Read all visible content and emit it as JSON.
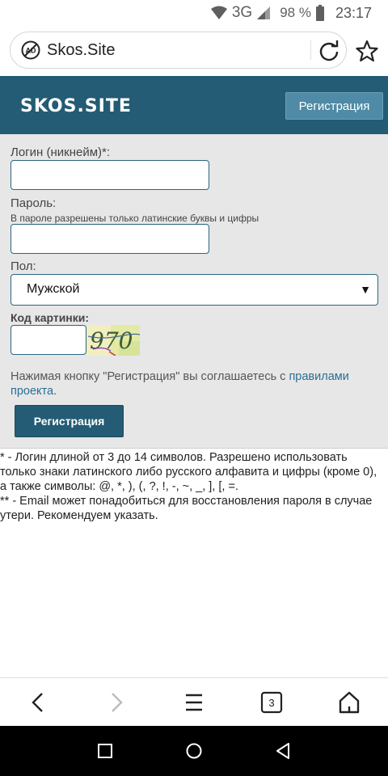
{
  "status": {
    "network": "3G",
    "battery": "98 %",
    "time": "23:17"
  },
  "browser": {
    "url": "Skos.Site"
  },
  "header": {
    "logo_text": "SKOS.SITE",
    "register_label": "Регистрация"
  },
  "form": {
    "login_label": "Логин (никнейм)*:",
    "login_value": "",
    "password_label": "Пароль:",
    "password_hint": "В пароле разрешены только латинские буквы и цифры",
    "password_value": "",
    "gender_label": "Пол:",
    "gender_selected": "Мужской",
    "captcha_label": "Код картинки:",
    "captcha_text": "970",
    "captcha_value": "",
    "agree_text": "Нажимая кнопку \"Регистрация\" вы соглашаетесь с ",
    "agree_link": "правилами проекта",
    "agree_end": ".",
    "submit_label": "Регистрация"
  },
  "notes": {
    "note1": "* - Логин длиной от 3 до 14 символов. Разрешено использовать только знаки латинского либо русского алфавита и цифры (кроме 0), а также символы: @, *, ), (, ?, !, -, ~, _, ], [, =.",
    "note2": "** - Email может понадобиться для восстановления пароля в случае утери. Рекомендуем указать."
  },
  "toolbar": {
    "tabs_count": "3"
  },
  "colors": {
    "header_bg": "#235c74",
    "button_bg": "#235c74",
    "header_button_bg": "#4f8aa6",
    "form_bg": "#e7e7e7",
    "link": "#2a6f93"
  }
}
